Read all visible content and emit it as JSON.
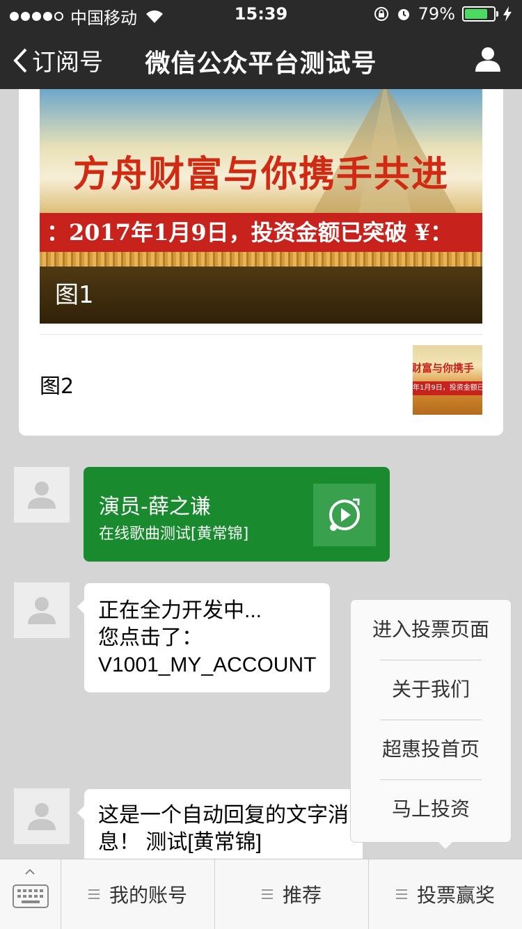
{
  "status_bar": {
    "carrier": "中国移动",
    "time": "15:39",
    "battery_percent_text": "79%",
    "battery_level": 0.79,
    "battery_color": "#4cd964"
  },
  "nav": {
    "back_label": "订阅号",
    "title": "微信公众平台测试号",
    "icons": {
      "back": "chevron-left-icon",
      "profile": "user-icon"
    }
  },
  "news": {
    "banner_slogan": "方舟财富与你携手共进",
    "banner_strip": "：2017年1月9日，投资金额已突破 ¥：",
    "item1_caption": "图1",
    "item2_title": "图2",
    "thumb_slogan": "财富与你携手",
    "thumb_strip": "年1月9日，投资金额已"
  },
  "music_message": {
    "title": "演员-薛之谦",
    "subtitle": "在线歌曲测试[黄常锦]",
    "color": "#1a8a2f",
    "icon": "music-play-icon"
  },
  "text_messages": [
    {
      "lines": [
        "正在全力开发中...",
        "您点击了：",
        "V1001_MY_ACCOUNT"
      ]
    },
    {
      "lines": [
        "这是一个自动回复的文字消",
        "息！ 测试[黄常锦]"
      ]
    }
  ],
  "popup_menu": {
    "items": [
      "进入投票页面",
      "关于我们",
      "超惠投首页",
      "马上投资"
    ]
  },
  "bottom_menu": {
    "keyboard_icon": "keyboard-icon",
    "items": [
      "我的账号",
      "推荐",
      "投票赢奖"
    ]
  }
}
